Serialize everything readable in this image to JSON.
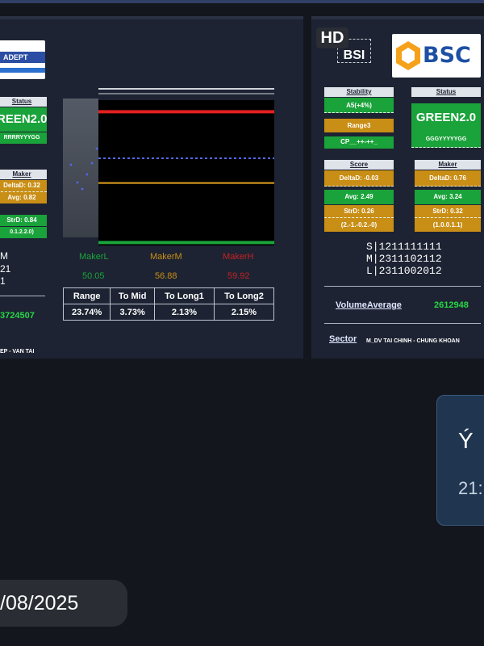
{
  "left_panel": {
    "logo_text": "ADEPT",
    "status_card": {
      "title": "Status",
      "value": "REEN2.0",
      "code": "RRRRYYYGG"
    },
    "maker_card": {
      "title": "Maker",
      "rows": [
        "DeltaD: 0.32",
        "Avg: 0.82",
        "StrD: 0.84",
        "0.1.2.2.0)"
      ]
    },
    "side_lines": [
      "M",
      "21",
      "1"
    ],
    "volume_value": "3724507",
    "sector_text": "EP - VAN TAI",
    "chart_data": {
      "type": "line",
      "series": [
        {
          "name": "red_line",
          "values": [
            92
          ]
        },
        {
          "name": "blue_dotted",
          "values": [
            60
          ]
        },
        {
          "name": "orange_line",
          "values": [
            43
          ]
        },
        {
          "name": "green_base",
          "values": [
            2
          ]
        }
      ],
      "ylim": [
        0,
        100
      ]
    },
    "legend": [
      {
        "name": "MakerL",
        "value": "50.05",
        "color": "#1aa33a"
      },
      {
        "name": "MakerM",
        "value": "56.88",
        "color": "#c98e15"
      },
      {
        "name": "MakerH",
        "value": "59.92",
        "color": "#c42323"
      }
    ],
    "metrics": [
      {
        "label": "Range",
        "value": "23.74%"
      },
      {
        "label": "To Mid",
        "value": "3.73%"
      },
      {
        "label": "To Long1",
        "value": "2.13%"
      },
      {
        "label": "To Long2",
        "value": "2.15%"
      }
    ]
  },
  "right_panel": {
    "badge": "HD",
    "bsi_logo": "BSI",
    "bsc_logo": "BSC",
    "stability_card": {
      "title": "Stability",
      "rows": [
        "A5(+4%)",
        "Range3",
        "CP__++-++_"
      ]
    },
    "status_card": {
      "title": "Status",
      "value": "GREEN2.0",
      "code": "GGGYYYYYGG"
    },
    "score_card": {
      "title": "Score",
      "rows": [
        "DeltaD: -0.03",
        "Avg: 2.49",
        "StrD: 0.26",
        "(2.-1.-0.2.-0)"
      ]
    },
    "maker_card": {
      "title": "Maker",
      "rows": [
        "DeltaD: 0.76",
        "Avg: 3.24",
        "StrD: 0.32",
        "(1.0.0.1.1)"
      ]
    },
    "slm_lines": [
      "S|1211111111",
      "M|2311102112",
      "L|2311002012"
    ],
    "volume_label": "VolumeAverage",
    "volume_value": "2612948",
    "sector_label": "Sector",
    "sector_value": "M_DV TAI CHINH - CHUNG KHOAN"
  },
  "chat": {
    "bubble_line1": "Ý",
    "bubble_line2": "21:",
    "date": "/08/2025"
  }
}
